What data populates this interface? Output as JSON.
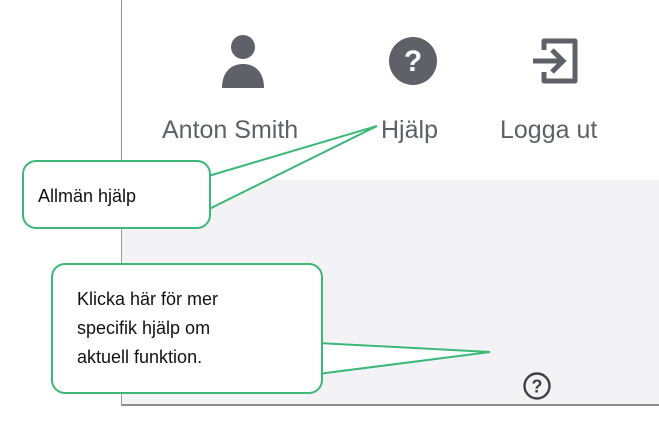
{
  "header": {
    "user_name": "Anton Smith",
    "help_label": "Hjälp",
    "logout_label": "Logga ut"
  },
  "callouts": {
    "general": "Allmän hjälp",
    "specific_lines": [
      "Klicka här för mer",
      "specifik hjälp om",
      "aktuell funktion."
    ]
  },
  "icons": {
    "user": "user-icon",
    "help": "help-circle-icon",
    "logout": "logout-icon",
    "context_help": "context-help-icon"
  },
  "colors": {
    "icon": "#5f6169",
    "callout_border": "#3cb878"
  }
}
